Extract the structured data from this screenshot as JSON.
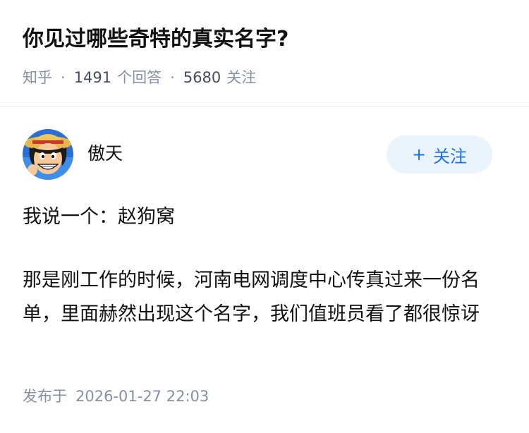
{
  "question": {
    "title": "你见过哪些奇特的真实名字?",
    "source": "知乎",
    "answer_count": "1491",
    "answer_count_label": "个回答",
    "follower_count": "5680",
    "follower_label": "关注"
  },
  "answer": {
    "author_name": "傲天",
    "follow_label": "关注",
    "follow_icon": "plus-icon",
    "paragraphs": [
      "我说一个：赵狗窝",
      "那是刚工作的时候，河南电网调度中心传真过来一份名单，里面赫然出现这个名字，我们值班员看了都很惊讶"
    ],
    "published_label": "发布于",
    "published_time": "2026-01-27 22:03"
  },
  "colors": {
    "accent": "#1772f6",
    "follow_bg": "#ebf3fc",
    "meta": "#8590a6",
    "text": "#121212"
  }
}
